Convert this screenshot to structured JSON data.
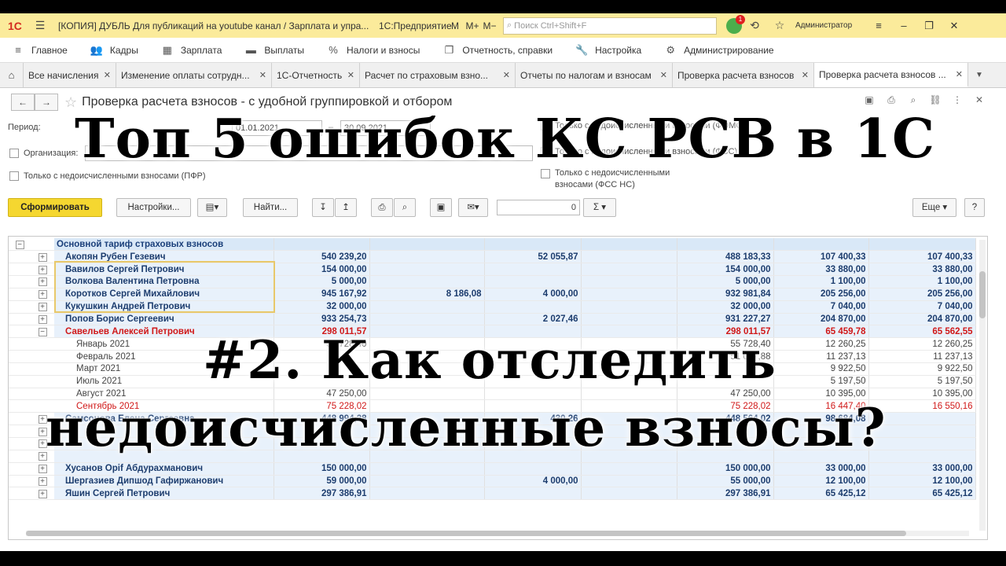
{
  "titlebar": {
    "logo": "1С",
    "title": "[КОПИЯ] ДУБЛЬ Для публикаций на youtube канал / Зарплата и упра...",
    "app": "1С:Предприятие",
    "m1": "M",
    "m2": "M+",
    "m3": "M−",
    "search_placeholder": "Поиск Ctrl+Shift+F",
    "notif_count": "1",
    "user": "Администратор"
  },
  "main_menu": [
    {
      "label": "Главное",
      "icon": "≡"
    },
    {
      "label": "Кадры",
      "icon": "👥"
    },
    {
      "label": "Зарплата",
      "icon": "▦"
    },
    {
      "label": "Выплаты",
      "icon": "▬"
    },
    {
      "label": "Налоги и взносы",
      "icon": "%"
    },
    {
      "label": "Отчетность, справки",
      "icon": "❐"
    },
    {
      "label": "Настройка",
      "icon": "🔧"
    },
    {
      "label": "Администрирование",
      "icon": "⚙"
    }
  ],
  "tabs": [
    {
      "label": "Все начисления"
    },
    {
      "label": "Изменение оплаты сотрудн..."
    },
    {
      "label": "1С-Отчетность"
    },
    {
      "label": "Расчет по страховым взно..."
    },
    {
      "label": "Отчеты по налогам и взносам"
    },
    {
      "label": "Проверка расчета взносов"
    },
    {
      "label": "Проверка расчета взносов ..."
    }
  ],
  "form": {
    "title": "Проверка расчета взносов - с удобной группировкой и отбором",
    "period_label": "Период:",
    "date_from": "01.01.2021",
    "date_sep": "–",
    "date_to": "30.09.2021",
    "org_label": "Организация:",
    "chk_pfr": "Только с недоисчисленными взносами (ПФР)",
    "chk_foms": "Только с недоисчисленными взносами (ФОМС)",
    "chk_fss": "Только с недоисчисленными взносами (ФСС)",
    "chk_fss_ns_1": "Только с недоисчисленными",
    "chk_fss_ns_2": "взносами (ФСС НС)"
  },
  "toolbar": {
    "generate": "Сформировать",
    "settings": "Настройки...",
    "find": "Найти...",
    "num_value": "0",
    "sum": "Σ",
    "more": "Еще",
    "help": "?"
  },
  "grid": {
    "group_title": "Основной тариф страховых взносов",
    "rows": [
      {
        "kind": "emp",
        "name": "Акопян Рубен Гезевич",
        "c1": "540 239,20",
        "c2": "",
        "c3": "52 055,87",
        "c4": "",
        "c5": "488 183,33",
        "c6": "107 400,33",
        "c7": "107 400,33"
      },
      {
        "kind": "emp",
        "name": "Вавилов Сергей Петрович",
        "c1": "154 000,00",
        "c2": "",
        "c3": "",
        "c4": "",
        "c5": "154 000,00",
        "c6": "33 880,00",
        "c7": "33 880,00"
      },
      {
        "kind": "emp",
        "name": "Волкова Валентина Петровна",
        "c1": "5 000,00",
        "c2": "",
        "c3": "",
        "c4": "",
        "c5": "5 000,00",
        "c6": "1 100,00",
        "c7": "1 100,00"
      },
      {
        "kind": "emp",
        "name": "Коротков Сергей Михайлович",
        "c1": "945 167,92",
        "c2": "8 186,08",
        "c3": "4 000,00",
        "c4": "",
        "c5": "932 981,84",
        "c6": "205 256,00",
        "c7": "205 256,00"
      },
      {
        "kind": "emp",
        "name": "Кукушкин Андрей Петрович",
        "c1": "32 000,00",
        "c2": "",
        "c3": "",
        "c4": "",
        "c5": "32 000,00",
        "c6": "7 040,00",
        "c7": "7 040,00"
      },
      {
        "kind": "emp",
        "name": "Попов Борис Сергеевич",
        "c1": "933 254,73",
        "c2": "",
        "c3": "2 027,46",
        "c4": "",
        "c5": "931 227,27",
        "c6": "204 870,00",
        "c7": "204 870,00"
      },
      {
        "kind": "red",
        "name": "Савельев Алексей Петрович",
        "c1": "298 011,57",
        "c2": "",
        "c3": "",
        "c4": "",
        "c5": "298 011,57",
        "c6": "65 459,78",
        "c7": "65 562,55"
      },
      {
        "kind": "month",
        "name": "Январь 2021",
        "c1": "55 728,40",
        "c2": "",
        "c3": "",
        "c4": "",
        "c5": "55 728,40",
        "c6": "12 260,25",
        "c7": "12 260,25"
      },
      {
        "kind": "month",
        "name": "Февраль 2021",
        "c1": "",
        "c2": "",
        "c3": "",
        "c4": "",
        "c5": "51 077,88",
        "c6": "11 237,13",
        "c7": "11 237,13"
      },
      {
        "kind": "month",
        "name": "Март 2021",
        "c1": "",
        "c2": "",
        "c3": "",
        "c4": "",
        "c5": "",
        "c6": "9 922,50",
        "c7": "9 922,50"
      },
      {
        "kind": "month",
        "name": "Июль 2021",
        "c1": "",
        "c2": "",
        "c3": "",
        "c4": "",
        "c5": "",
        "c6": "5 197,50",
        "c7": "5 197,50"
      },
      {
        "kind": "month",
        "name": "Август 2021",
        "c1": "47 250,00",
        "c2": "",
        "c3": "",
        "c4": "",
        "c5": "47 250,00",
        "c6": "10 395,00",
        "c7": "10 395,00"
      },
      {
        "kind": "month-red",
        "name": "Сентябрь 2021",
        "c1": "75 228,02",
        "c2": "",
        "c3": "",
        "c4": "",
        "c5": "75 228,02",
        "c6": "16 447,40",
        "c7": "16 550,16"
      },
      {
        "kind": "emp",
        "name": "Самсонова Елена Сергеевна",
        "c1": "448 994,28",
        "c2": "",
        "c3": "430,26",
        "c4": "",
        "c5": "448 564,02",
        "c6": "98 684,08",
        "c7": ""
      },
      {
        "kind": "emp",
        "name": "",
        "c1": "",
        "c2": "",
        "c3": "",
        "c4": "",
        "c5": "",
        "c6": "",
        "c7": ""
      },
      {
        "kind": "emp",
        "name": "",
        "c1": "",
        "c2": "",
        "c3": "",
        "c4": "",
        "c5": "",
        "c6": "",
        "c7": ""
      },
      {
        "kind": "emp",
        "name": "",
        "c1": "",
        "c2": "",
        "c3": "",
        "c4": "",
        "c5": "",
        "c6": "",
        "c7": ""
      },
      {
        "kind": "emp",
        "name": "Хусанов Орif Абдурахманович",
        "c1": "150 000,00",
        "c2": "",
        "c3": "",
        "c4": "",
        "c5": "150 000,00",
        "c6": "33 000,00",
        "c7": "33 000,00"
      },
      {
        "kind": "emp",
        "name": "Шергазиев Дипшод Гафиржанович",
        "c1": "59 000,00",
        "c2": "",
        "c3": "4 000,00",
        "c4": "",
        "c5": "55 000,00",
        "c6": "12 100,00",
        "c7": "12 100,00"
      },
      {
        "kind": "emp",
        "name": "Яшин Сергей Петрович",
        "c1": "297 386,91",
        "c2": "",
        "c3": "",
        "c4": "",
        "c5": "297 386,91",
        "c6": "65 425,12",
        "c7": "65 425,12"
      }
    ]
  },
  "overlay": {
    "line1": "Топ 5 ошибок КС РСВ в 1С",
    "line2": "#2. Как отследить",
    "line3": "недоисчисленные взносы?"
  },
  "colors": {
    "titlebar_bg": "#fbeb9b",
    "primary_button": "#f5d730",
    "row_blue": "#e8f1fb",
    "text_red": "#d01818"
  }
}
